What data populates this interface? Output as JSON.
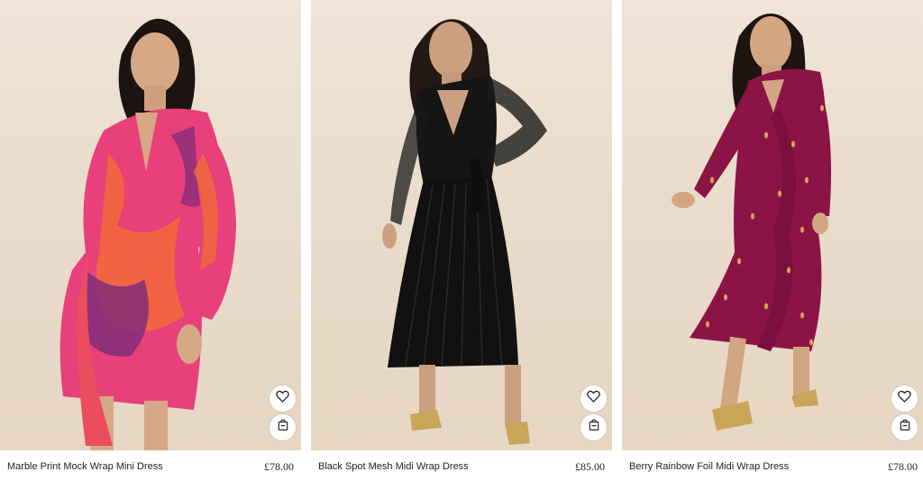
{
  "colors": {
    "background": "#ffffff",
    "photo_background": "#ecdfcf",
    "text": "#222222",
    "button_background": "#ffffff"
  },
  "products": [
    {
      "name": "Marble Print Mock Wrap Mini Dress",
      "price": "£78.00",
      "wishlist_icon": "heart-icon",
      "bag_icon": "shopping-bag-icon",
      "dress_colors": [
        "#e7407b",
        "#f26a3a",
        "#7c2a7a"
      ]
    },
    {
      "name": "Black Spot Mesh Midi Wrap Dress",
      "price": "£85.00",
      "wishlist_icon": "heart-icon",
      "bag_icon": "shopping-bag-icon",
      "dress_colors": [
        "#131313"
      ]
    },
    {
      "name": "Berry Rainbow Foil Midi Wrap Dress",
      "price": "£78.00",
      "wishlist_icon": "heart-icon",
      "bag_icon": "shopping-bag-icon",
      "dress_colors": [
        "#8c1346",
        "#d4a84a"
      ]
    }
  ]
}
